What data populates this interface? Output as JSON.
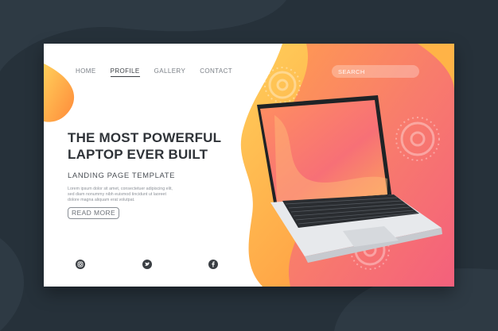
{
  "nav": {
    "items": [
      {
        "label": "HOME",
        "active": false
      },
      {
        "label": "PROFILE",
        "active": true
      },
      {
        "label": "GALLERY",
        "active": false
      },
      {
        "label": "CONTACT",
        "active": false
      }
    ]
  },
  "search": {
    "placeholder": "SEARCH"
  },
  "hero": {
    "title": "THE MOST POWERFUL LAPTOP EVER BUILT",
    "subtitle": "LANDING PAGE TEMPLATE",
    "body": "Lorem ipsum dolor sit amet, consectetuer adipiscing elit, sed diam nonummy nibh euismod tincidunt ut laoreet dolore magna aliquam erat volutpat.",
    "button_label": "READ MORE"
  },
  "social": {
    "icons": [
      "instagram-icon",
      "twitter-icon",
      "facebook-icon"
    ]
  },
  "colors": {
    "background": "#26313a",
    "card": "#ffffff",
    "accent_orange": "#ffab3a",
    "accent_pink": "#f5727a",
    "text_dark": "#2f3338"
  }
}
